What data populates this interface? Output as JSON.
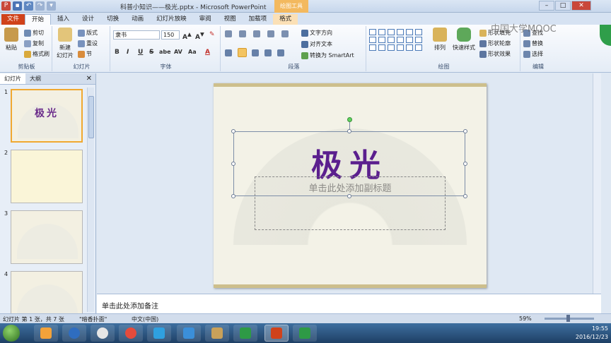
{
  "window": {
    "title": "科普小知识——极光.pptx - Microsoft PowerPoint",
    "context_tool": "绘图工具",
    "minimize": "–",
    "maximize": "□",
    "close": "✕"
  },
  "tabs": [
    "文件",
    "开始",
    "插入",
    "设计",
    "切换",
    "动画",
    "幻灯片放映",
    "审阅",
    "视图",
    "加载项",
    "格式"
  ],
  "ribbon": {
    "clipboard": {
      "label": "剪贴板",
      "paste": "粘贴",
      "cut": "剪切",
      "copy": "复制",
      "format_painter": "格式刷"
    },
    "slides": {
      "label": "幻灯片",
      "new_slide": "新建\n幻灯片",
      "layout": "版式",
      "reset": "重设",
      "section": "节"
    },
    "font": {
      "label": "字体",
      "font_name": "隶书",
      "font_size": "150",
      "bold": "B",
      "italic": "I",
      "underline": "U",
      "strike": "S",
      "shadow": "abe",
      "spacing": "AV",
      "case": "Aa",
      "color": "A"
    },
    "paragraph": {
      "label": "段落",
      "text_direction": "文字方向",
      "align_text": "对齐文本",
      "smartart": "转换为 SmartArt"
    },
    "drawing": {
      "label": "绘图",
      "arrange": "排列",
      "quick_styles": "快速样式",
      "shape_fill": "形状填充",
      "shape_outline": "形状轮廓",
      "shape_effects": "形状效果"
    },
    "editing": {
      "label": "编辑",
      "find": "查找",
      "replace": "替换",
      "select": "选择"
    }
  },
  "left_panel": {
    "tab_slides": "幻灯片",
    "tab_outline": "大纲",
    "close": "✕",
    "thumbnails": [
      {
        "num": "1",
        "title": "极光"
      },
      {
        "num": "2",
        "title": ""
      },
      {
        "num": "3",
        "title": ""
      },
      {
        "num": "4",
        "title": ""
      }
    ]
  },
  "slide": {
    "title": "极光",
    "subtitle_placeholder": "单击此处添加副标题"
  },
  "notes_placeholder": "单击此处添加备注",
  "status": {
    "slide_info": "幻灯片 第 1 张，共 7 张",
    "theme": "\"暗香扑面\"",
    "language": "中文(中国)",
    "zoom": "59%"
  },
  "watermark": "中国大学MOOC",
  "taskbar": {
    "time": "19:55",
    "date": "2016/12/23"
  }
}
